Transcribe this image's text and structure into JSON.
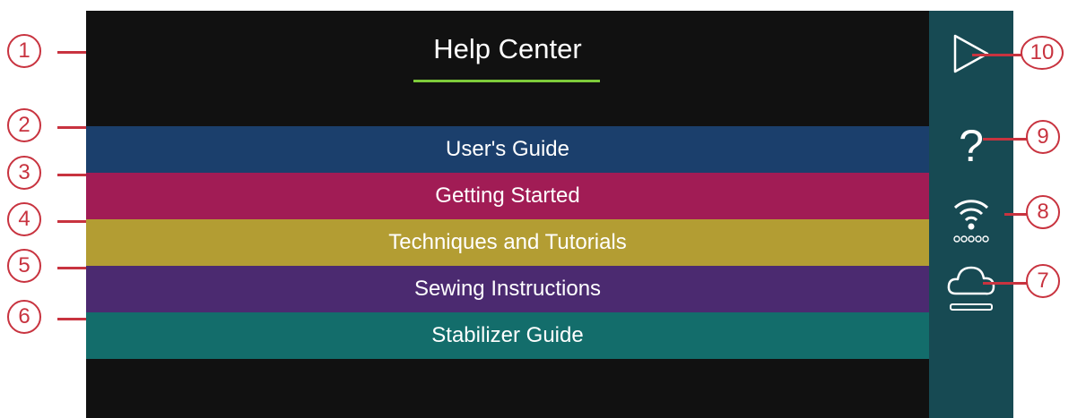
{
  "header": {
    "title": "Help Center"
  },
  "menu": [
    {
      "label": "User's Guide",
      "color": "#1b3f6c"
    },
    {
      "label": "Getting Started",
      "color": "#a11c55"
    },
    {
      "label": "Techniques and Tutorials",
      "color": "#b39d33"
    },
    {
      "label": "Sewing Instructions",
      "color": "#4b2a70"
    },
    {
      "label": "Stabilizer Guide",
      "color": "#136d6b"
    }
  ],
  "sidebar": {
    "buttons": [
      {
        "icon": "play-icon"
      },
      {
        "icon": "question-mark-icon",
        "glyph": "?"
      },
      {
        "icon": "wifi-icon"
      },
      {
        "icon": "cloud-icon"
      }
    ]
  },
  "callouts": [
    "1",
    "2",
    "3",
    "4",
    "5",
    "6",
    "7",
    "8",
    "9",
    "10"
  ],
  "colors": {
    "screen_bg": "#111111",
    "sidebar_bg": "#174a53",
    "underline": "#7ecb3a",
    "callout": "#c8333f"
  }
}
